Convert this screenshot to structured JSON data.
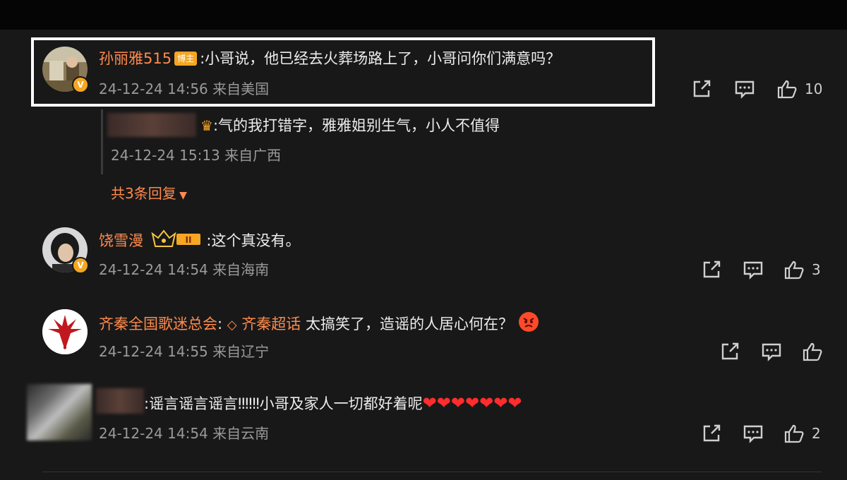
{
  "comments": [
    {
      "username": "孙丽雅515",
      "tag": "博主",
      "text": ":小哥说，他已经去火葬场路上了，小哥问你们满意吗？",
      "timestamp": "24-12-24 14:56 来自美国",
      "likes": "10"
    },
    {
      "username": "饶雪漫",
      "text": ":这个真没有。",
      "timestamp": "24-12-24 14:54 来自海南",
      "likes": "3"
    },
    {
      "username": "齐秦全国歌迷总会",
      "separator": ":",
      "topic": "齐秦超话",
      "text": " 太搞笑了，造谣的人居心何在？",
      "timestamp": "24-12-24 14:55 来自辽宁",
      "likes": ""
    },
    {
      "text": ":谣言谣言谣言‼‼‼小哥及家人一切都好着呢",
      "hearts": "❤❤❤❤❤❤❤",
      "timestamp": "24-12-24 14:54 来自云南",
      "likes": "2"
    }
  ],
  "reply": {
    "text": ":气的我打错字，雅雅姐别生气，小人不值得",
    "timestamp": "24-12-24 15:13 来自广西",
    "more_label": "共3条回复"
  },
  "colors": {
    "background": "#181818",
    "username": "#ff8a4d",
    "highlight_border": "#ffffff"
  },
  "icons": [
    "share-icon",
    "comment-icon",
    "like-icon",
    "crown-icon",
    "diamond-icon",
    "angry-emoji-icon",
    "dropdown-triangle-icon"
  ]
}
